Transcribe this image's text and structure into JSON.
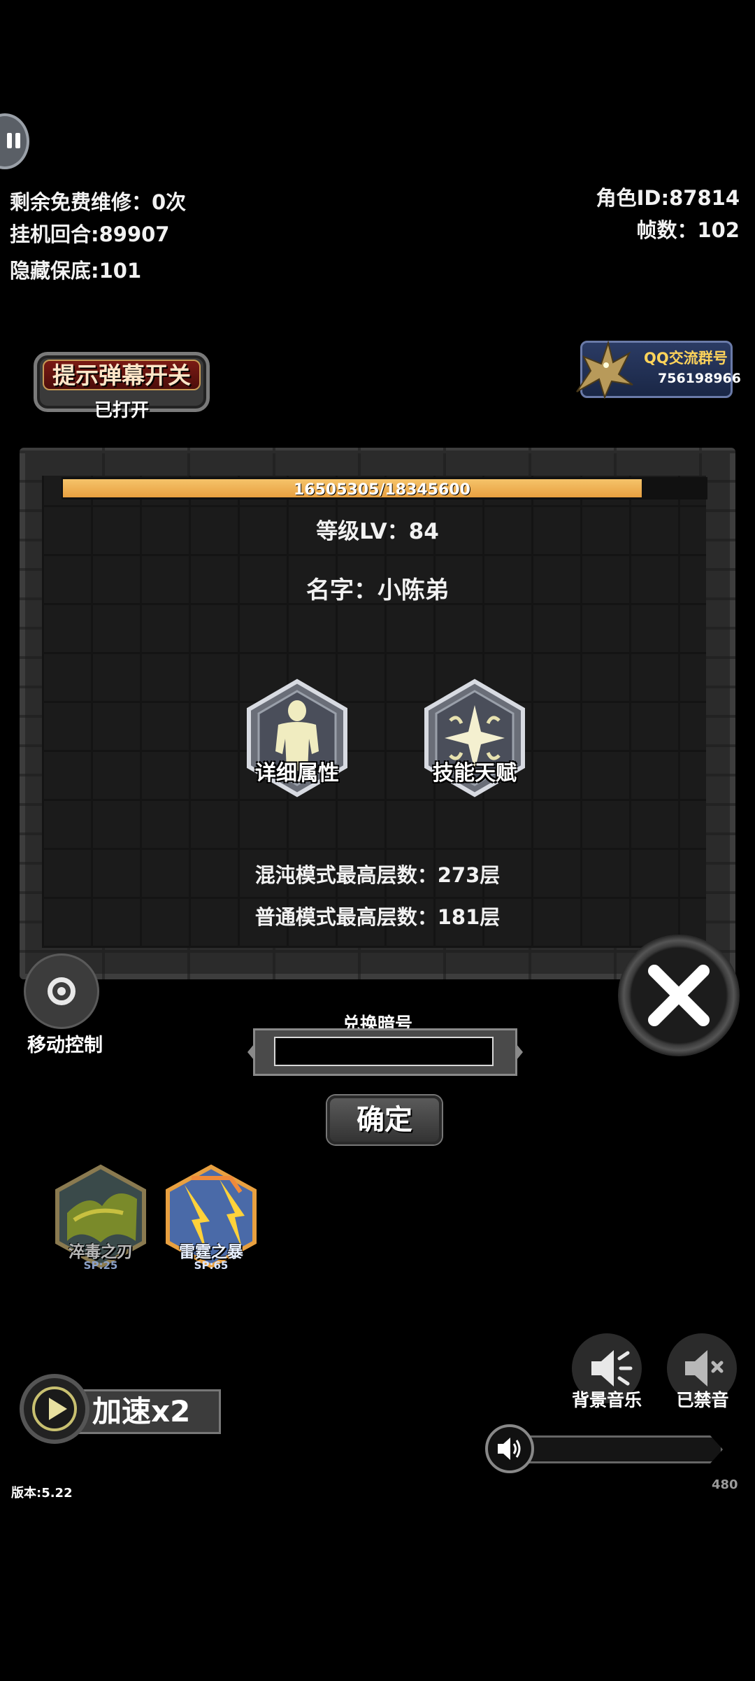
{
  "hud": {
    "free_repairs": "剩余免费维修：0次",
    "idle_rounds": "挂机回合:89907",
    "hidden_pity": "隐藏保底:101",
    "role_id": "角色ID:87814",
    "fps": "帧数：102"
  },
  "danmaku_toggle": {
    "title": "提示弹幕开关",
    "status": "已打开"
  },
  "qq_group": {
    "title": "QQ交流群号",
    "number": "756198966"
  },
  "character": {
    "hp_text": "16505305/18345600",
    "hp_current": 16505305,
    "hp_max": 18345600,
    "level": "等级LV：84",
    "name": "名字：小陈弟",
    "detail_attr_label": "详细属性",
    "skill_talent_label": "技能天赋",
    "chaos_max_floor": "混沌模式最高层数：273层",
    "normal_max_floor": "普通模式最高层数：181层"
  },
  "move_control": {
    "label": "移动控制"
  },
  "redeem": {
    "title": "兑换暗号",
    "value": "",
    "confirm_label": "确定"
  },
  "skills": [
    {
      "name": "淬毒之刃",
      "sp": "SP:25",
      "icon": "poison-blade-icon"
    },
    {
      "name": "雷霆之暴",
      "sp": "SP:65",
      "icon": "thunder-storm-icon"
    }
  ],
  "speed": {
    "label": "加速x2"
  },
  "audio": {
    "bgm_label": "背景音乐",
    "mute_label": "已禁音"
  },
  "footer": {
    "version": "版本:5.22",
    "fps_small": "480"
  },
  "colors": {
    "hp_bar": "#e8a040",
    "background": "#000000",
    "panel": "#2b2b2b"
  }
}
